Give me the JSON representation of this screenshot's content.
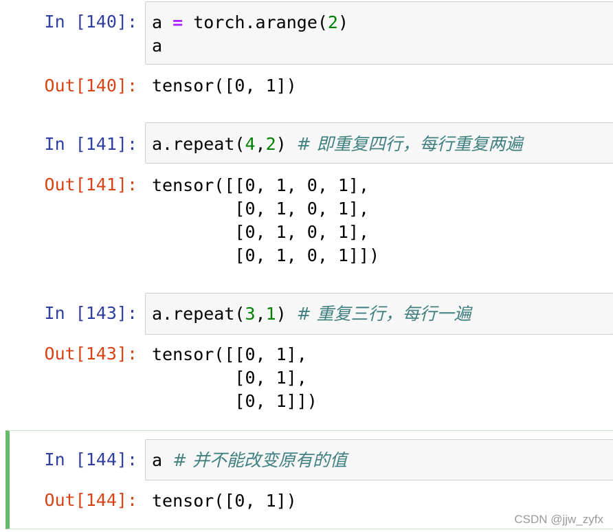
{
  "cells": [
    {
      "in_prompt": "In [140]:",
      "code": {
        "l1_var": "a",
        "l1_op": "=",
        "l1_call": "torch.arange(",
        "l1_num": "2",
        "l1_close": ")",
        "l2": "a"
      },
      "out_prompt": "Out[140]:",
      "output": [
        "tensor([0, 1])"
      ]
    },
    {
      "in_prompt": "In [141]:",
      "code": {
        "l1_call": "a.repeat(",
        "l1_num1": "4",
        "l1_comma": ",",
        "l1_num2": "2",
        "l1_close": ")",
        "l1_comment": "# 即重复四行，每行重复两遍"
      },
      "out_prompt": "Out[141]:",
      "output": [
        "tensor([[0, 1, 0, 1],",
        "        [0, 1, 0, 1],",
        "        [0, 1, 0, 1],",
        "        [0, 1, 0, 1]])"
      ]
    },
    {
      "in_prompt": "In [143]:",
      "code": {
        "l1_call": "a.repeat(",
        "l1_num1": "3",
        "l1_comma": ",",
        "l1_num2": "1",
        "l1_close": ")",
        "l1_comment": "# 重复三行，每行一遍"
      },
      "out_prompt": "Out[143]:",
      "output": [
        "tensor([[0, 1],",
        "        [0, 1],",
        "        [0, 1]])"
      ]
    },
    {
      "in_prompt": "In [144]:",
      "code": {
        "l1_var": "a",
        "l1_comment": "# 并不能改变原有的值"
      },
      "out_prompt": "Out[144]:",
      "output": [
        "tensor([0, 1])"
      ]
    }
  ],
  "watermark": "CSDN @jjw_zyfx",
  "colors": {
    "in_prompt": "#303f9f",
    "out_prompt": "#d84315",
    "selected_border": "#66bb6a",
    "keyword_op": "#aa22ff",
    "number": "#008000",
    "comment": "#408080"
  }
}
